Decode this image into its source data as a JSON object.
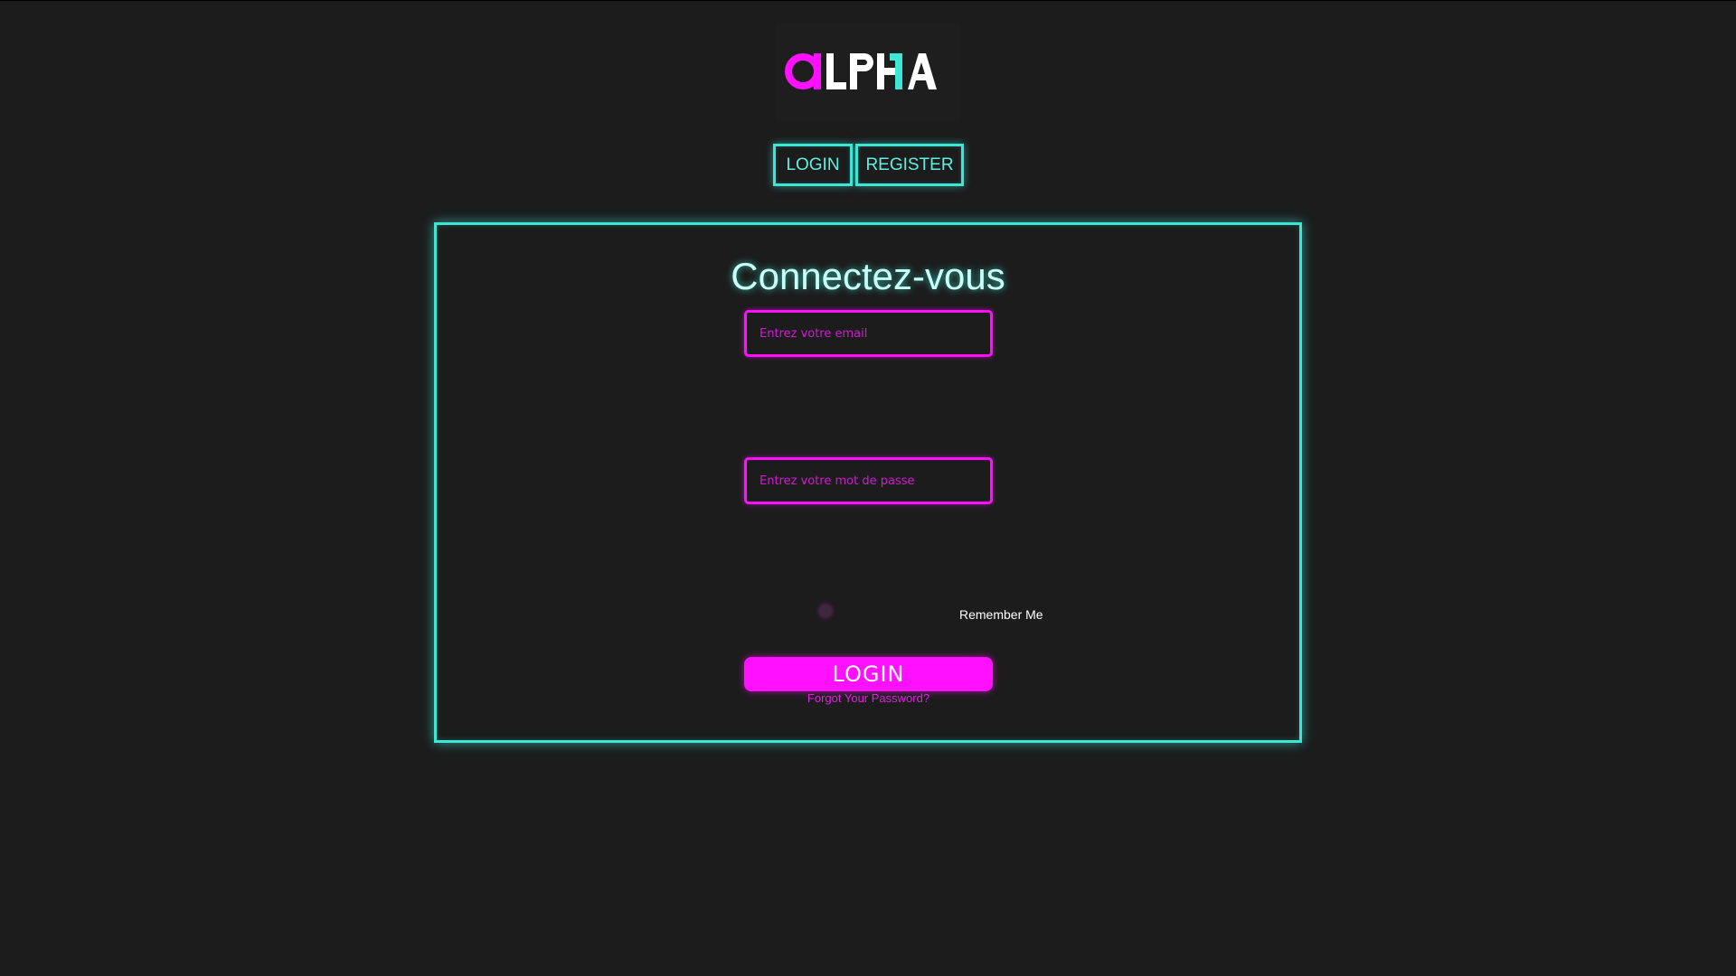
{
  "brand": {
    "logo_text": "ALPHA",
    "colors": {
      "accent_magenta": "#ff10ff",
      "accent_cyan": "#3ee6d6",
      "background": "#1c1c1c"
    }
  },
  "nav": {
    "login_label": "LOGIN",
    "register_label": "REGISTER"
  },
  "form": {
    "title": "Connectez-vous",
    "email_placeholder": "Entrez votre email",
    "email_value": "",
    "password_placeholder": "Entrez votre mot de passe",
    "password_value": "",
    "remember_label": "Remember Me",
    "remember_checked": false,
    "submit_label": "LOGIN",
    "forgot_label": "Forgot Your Password?"
  }
}
